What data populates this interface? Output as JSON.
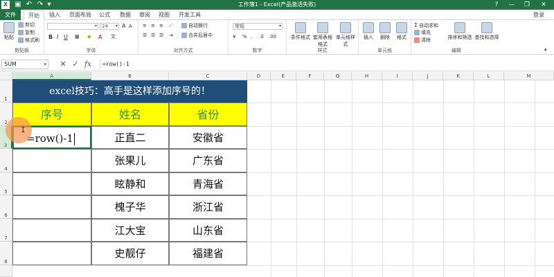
{
  "window": {
    "title": "工作簿1 - Excel(产品激活失败)",
    "login": "登录"
  },
  "quick_access": [
    "save-icon",
    "undo-icon",
    "redo-icon"
  ],
  "tabs": [
    "文件",
    "开始",
    "插入",
    "页面布局",
    "公式",
    "数据",
    "审阅",
    "视图",
    "开发工具"
  ],
  "ribbon": {
    "clipboard": {
      "label": "剪贴板",
      "paste": "粘贴",
      "cut": "剪切",
      "copy": "复制",
      "format_painter": "格式刷"
    },
    "font": {
      "label": "字体",
      "font_size": "24"
    },
    "alignment": {
      "label": "对齐方式",
      "wrap": "自动换行",
      "merge": "合并后居中"
    },
    "number": {
      "label": "数字",
      "format": "常规"
    },
    "styles": {
      "label": "样式",
      "conditional": "条件格式",
      "table": "套用表格格式",
      "cell_styles": "单元格样式"
    },
    "cells": {
      "label": "单元格",
      "insert": "插入",
      "delete": "删除",
      "format": "格式"
    },
    "editing": {
      "label": "编辑",
      "autosum": "自动求和",
      "fill": "填充",
      "clear": "清除",
      "sort": "排序和筛选",
      "find": "查找和选择"
    }
  },
  "formula_bar": {
    "name_box": "SUM",
    "formula": "=row()-1"
  },
  "columns": [
    "A",
    "B",
    "C",
    "D",
    "E",
    "F",
    "G",
    "H",
    "I",
    "J",
    "K",
    "L",
    "M"
  ],
  "rows": [
    "1",
    "2",
    "3",
    "4",
    "5",
    "6",
    "7",
    "8"
  ],
  "sheet": {
    "banner": "excel技巧：高手是这样添加序号的！",
    "headers": [
      "序号",
      "姓名",
      "省份"
    ],
    "editing_value": "=row()-1",
    "records": [
      {
        "name": "正直二",
        "province": "安徽省"
      },
      {
        "name": "张果儿",
        "province": "广东省"
      },
      {
        "name": "眩静和",
        "province": "青海省"
      },
      {
        "name": "槐子华",
        "province": "浙江省"
      },
      {
        "name": "江大宝",
        "province": "山东省"
      },
      {
        "name": "史靓仔",
        "province": "福建省"
      }
    ]
  },
  "colors": {
    "excel_green": "#217346",
    "banner_blue": "#1f4e79",
    "header_yellow": "#ffff00",
    "header_text": "#3a8f3a"
  }
}
